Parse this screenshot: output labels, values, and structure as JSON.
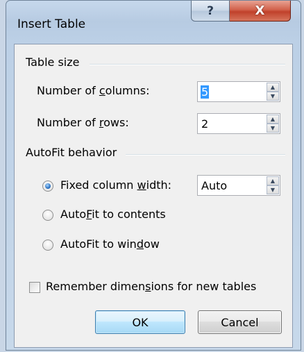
{
  "window": {
    "title": "Insert Table",
    "help_label": "?",
    "close_label": "X"
  },
  "table_size": {
    "heading": "Table size",
    "columns": {
      "label_pre": "Number of ",
      "label_key": "c",
      "label_post": "olumns:",
      "value": "5"
    },
    "rows": {
      "label_pre": "Number of ",
      "label_key": "r",
      "label_post": "ows:",
      "value": "2"
    }
  },
  "autofit": {
    "heading": "AutoFit behavior",
    "fixed": {
      "label_pre": "Fixed column ",
      "label_key": "w",
      "label_post": "idth:",
      "value": "Auto",
      "checked": true
    },
    "contents": {
      "label_pre": "Auto",
      "label_key": "F",
      "label_post": "it to contents",
      "checked": false
    },
    "window": {
      "label_pre": "AutoFit to win",
      "label_key": "d",
      "label_post": "ow",
      "checked": false
    }
  },
  "remember": {
    "label_pre": "Remember dimen",
    "label_key": "s",
    "label_post": "ions for new tables",
    "checked": false
  },
  "buttons": {
    "ok": "OK",
    "cancel": "Cancel"
  },
  "icons": {
    "help": "help-icon",
    "close": "close-icon",
    "spin_up": "spin-up-arrow-icon",
    "spin_down": "spin-down-arrow-icon"
  }
}
